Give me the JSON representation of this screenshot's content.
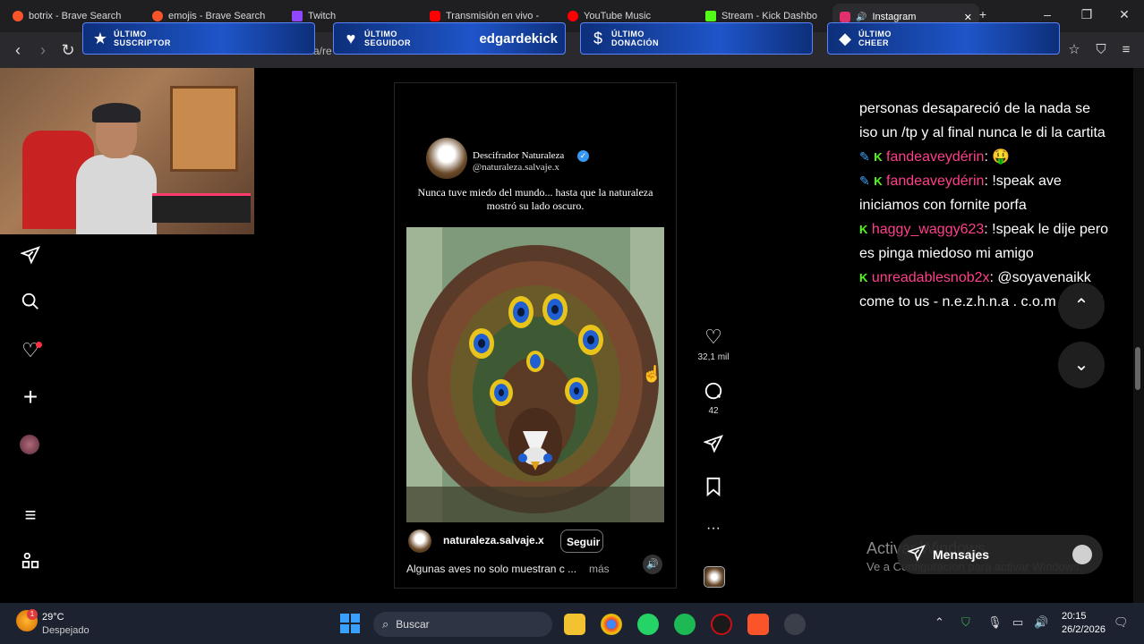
{
  "browser": {
    "tabs": [
      {
        "label": "botrix - Brave Search",
        "color": "#fb542b"
      },
      {
        "label": "emojis - Brave Search",
        "color": "#fb542b"
      },
      {
        "label": "Twitch",
        "color": "#9146ff"
      },
      {
        "label": "Transmisión en vivo -",
        "color": "#ff0000"
      },
      {
        "label": "YouTube Music",
        "color": "#ff0000"
      },
      {
        "label": "Stream - Kick Dashbo",
        "color": "#53fc18"
      },
      {
        "label": "Instagram",
        "color": "#e1306c",
        "active": true
      }
    ],
    "new_tab": "+",
    "url_fragment": "a/re",
    "window_controls": [
      "–",
      "❐",
      "✕"
    ]
  },
  "overlay": {
    "banners": [
      {
        "label_line1": "ÚLTIMO",
        "label_line2": "SUSCRIPTOR",
        "value": "",
        "icon": "star-icon"
      },
      {
        "label_line1": "ÚLTIMO",
        "label_line2": "SEGUIDOR",
        "value": "edgardekick",
        "icon": "heart-icon"
      },
      {
        "label_line1": "ÚLTIMO",
        "label_line2": "DONACIÓN",
        "value": "",
        "icon": "dollar-icon"
      },
      {
        "label_line1": "ÚLTIMO",
        "label_line2": "CHEER",
        "value": "",
        "icon": "diamond-icon"
      }
    ]
  },
  "instagram": {
    "nav_icons": [
      "send-icon",
      "search-icon",
      "heart-icon",
      "plus-icon",
      "profile-avatar",
      "menu-icon",
      "apps-icon"
    ],
    "reel": {
      "author_name": "Descifrador Naturaleza",
      "author_handle": "@naturaleza.salvaje.x",
      "caption_top": "Nunca tuve miedo del mundo... hasta que la naturaleza mostró su lado oscuro.",
      "footer_user": "naturaleza.salvaje.x",
      "follow_label": "Seguir",
      "description": "Algunas aves no solo muestran c ...",
      "more_label": "más"
    },
    "actions": {
      "likes": "32,1 mil",
      "comments": "42",
      "more": "···"
    },
    "messages_label": "Mensajes"
  },
  "chat": {
    "lines": [
      {
        "kind": "text",
        "text": "personas desapareció de la nada se iso un /tp y al final nunca le di la cartita"
      },
      {
        "kind": "msg",
        "user": "fandeaveydérin",
        "message": " 🤑",
        "pencil": true
      },
      {
        "kind": "msg",
        "user": "fandeaveydérin",
        "message": " !speak ave iniciamos con fornite porfa",
        "pencil": true
      },
      {
        "kind": "msg",
        "user": "haggy_waggy623",
        "message": " !speak le dije pero es pinga miedoso mi amigo",
        "pencil": false
      },
      {
        "kind": "msg",
        "user": "unreadablesnob2x",
        "message": " @soyavenaikk come to us - n.e.z.h.n.a . c.o.m YheHrl",
        "pencil": false
      }
    ]
  },
  "windows_watermark": {
    "title": "Activar Windows",
    "subtitle": "Ve a Configuración para activar Windows."
  },
  "taskbar": {
    "weather_temp": "29°C",
    "weather_desc": "Despejado",
    "weather_badge": "1",
    "search_placeholder": "Buscar",
    "time": "20:15",
    "date": "26/2/2026"
  }
}
